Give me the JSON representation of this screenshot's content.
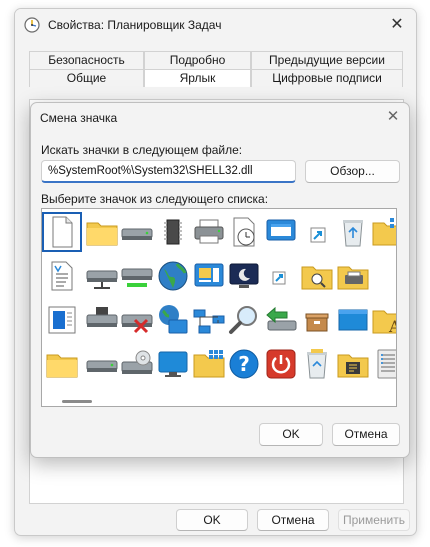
{
  "outer_window": {
    "title": "Свойства: Планировщик Задач",
    "close_glyph": "✕",
    "tabs_row1": [
      "Безопасность",
      "Подробно",
      "Предыдущие версии"
    ],
    "tabs_row2": [
      "Общие",
      "Ярлык",
      "Цифровые подписи"
    ],
    "active_tab": "Ярлык",
    "buttons": {
      "ok": "OK",
      "cancel": "Отмена",
      "apply": "Применить"
    }
  },
  "dialog": {
    "title": "Смена значка",
    "close_glyph": "✕",
    "file_label": "Искать значки в следующем файле:",
    "file_path": "%SystemRoot%\\System32\\SHELL32.dll",
    "browse_button": "Обзор...",
    "list_label": "Выберите значок из следующего списка:",
    "icons": [
      [
        "blank-document-icon",
        "folder-icon",
        "drive-icon",
        "memory-chip-icon",
        "printer-icon",
        "clock-document-icon",
        "monitor-window-icon",
        "shortcut-arrow-icon",
        "recycle-bin-empty-icon",
        "folder-grid-icon"
      ],
      [
        "text-document-icon",
        "network-drive-icon",
        "drive-green-icon",
        "globe-icon",
        "control-panel-icon",
        "sleep-monitor-icon",
        "shortcut-arrow-small-icon",
        "folder-search-icon",
        "printer-folder-icon",
        ""
      ],
      [
        "document-window-icon",
        "removable-drive-icon",
        "drive-error-icon",
        "network-globe-icon",
        "network-icon",
        "magnifier-icon",
        "drive-back-icon",
        "box-icon",
        "blue-window-icon",
        "font-folder-icon"
      ],
      [
        "folder-plain-icon",
        "drive-small-icon",
        "cd-drive-icon",
        "monitor-icon",
        "folder-tiles-icon",
        "help-icon",
        "power-icon",
        "recycle-bin-full-icon",
        "folder-tools-icon",
        "server-icon"
      ]
    ],
    "buttons": {
      "ok": "OK",
      "cancel": "Отмена"
    }
  }
}
